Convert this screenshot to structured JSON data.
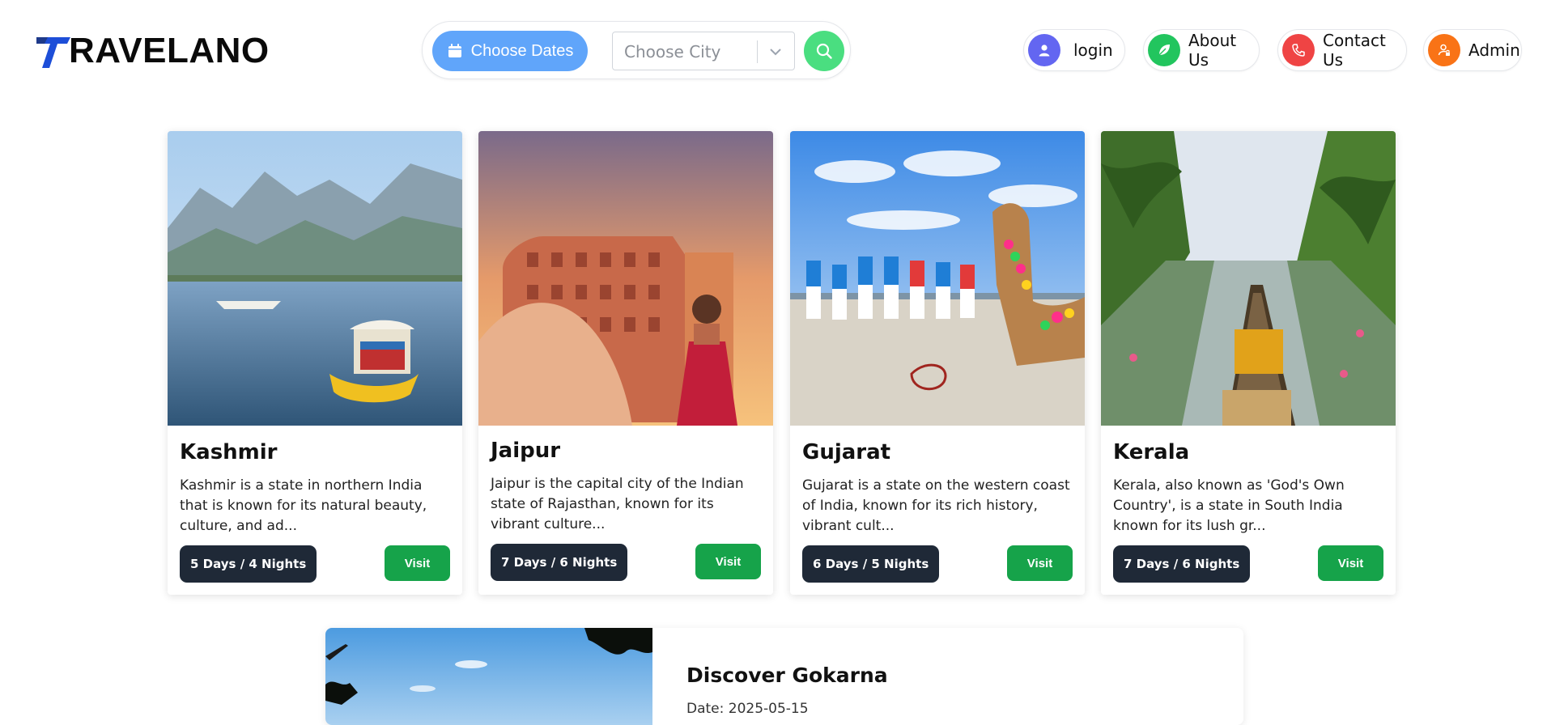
{
  "brand": {
    "name": "RAVELANO",
    "mark_color": "#1d4ed8"
  },
  "search": {
    "dates_label": "Choose Dates",
    "city_placeholder": "Choose City",
    "dates_color": "#60a5fa",
    "search_color": "#4ade80"
  },
  "nav": [
    {
      "label": "login",
      "icon": "user-icon",
      "color": "#6366f1"
    },
    {
      "label": "About Us",
      "icon": "leaf-icon",
      "color": "#22c55e"
    },
    {
      "label": "Contact Us",
      "icon": "phone-icon",
      "color": "#ef4444"
    },
    {
      "label": "Admin",
      "icon": "admin-icon",
      "color": "#f97316"
    }
  ],
  "cards": [
    {
      "title": "Kashmir",
      "description": "Kashmir is a state in northern India that is known for its natural beauty, culture, and ad...",
      "duration": "5 Days / 4 Nights",
      "visit": "Visit"
    },
    {
      "title": "Jaipur",
      "description": "Jaipur is the capital city of the Indian state of Rajasthan, known for its vibrant culture...",
      "duration": "7 Days / 6 Nights",
      "visit": "Visit"
    },
    {
      "title": "Gujarat",
      "description": "Gujarat is a state on the western coast of India, known for its rich history, vibrant cult...",
      "duration": "6 Days / 5 Nights",
      "visit": "Visit"
    },
    {
      "title": "Kerala",
      "description": "Kerala, also known as 'God's Own Country', is a state in South India known for its lush gr...",
      "duration": "7 Days / 6 Nights",
      "visit": "Visit"
    }
  ],
  "featured": {
    "title": "Discover Gokarna",
    "date": "Date: 2025-05-15"
  },
  "colors": {
    "duration_bg": "#1f2937",
    "visit_bg": "#16a34a"
  }
}
